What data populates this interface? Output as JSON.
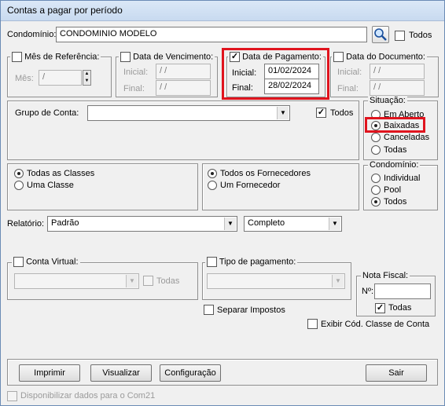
{
  "window": {
    "title": "Contas a pagar por período"
  },
  "condominio": {
    "label": "Condomínio:",
    "value": "CONDOMINIO MODELO",
    "todos_label": "Todos",
    "todos_checked": false
  },
  "mes_referencia": {
    "label": "Mês de Referência:",
    "mes_label": "Mês:",
    "mes_value": "  /"
  },
  "data_vencimento": {
    "label": "Data de Vencimento:",
    "inicial_label": "Inicial:",
    "final_label": "Final:",
    "inicial_value": " /  /",
    "final_value": " /  /"
  },
  "data_pagamento": {
    "label": "Data de Pagamento:",
    "checked": true,
    "inicial_label": "Inicial:",
    "final_label": "Final:",
    "inicial_value": "01/02/2024",
    "final_value": "28/02/2024"
  },
  "data_documento": {
    "label": "Data do Documento:",
    "inicial_label": "Inicial:",
    "final_label": "Final:",
    "inicial_value": " /  /",
    "final_value": " /  /"
  },
  "grupo_conta": {
    "label": "Grupo de Conta:",
    "value": "",
    "todos_label": "Todos",
    "todos_checked": true
  },
  "situacao": {
    "label": "Situação:",
    "options": [
      "Em Aberto",
      "Baixadas",
      "Canceladas",
      "Todas"
    ],
    "selected": "Baixadas"
  },
  "classes": {
    "options": [
      "Todas as Classes",
      "Uma Classe"
    ],
    "selected": "Todas as Classes"
  },
  "fornecedores": {
    "options": [
      "Todos os Fornecedores",
      "Um Fornecedor"
    ],
    "selected": "Todos os Fornecedores"
  },
  "condominio_group": {
    "label": "Condomínio:",
    "options": [
      "Individual",
      "Pool",
      "Todos"
    ],
    "selected": "Todos"
  },
  "relatorio": {
    "label": "Relatório:",
    "value": "Padrão",
    "detail_value": "Completo"
  },
  "conta_virtual": {
    "label": "Conta Virtual:",
    "todas_label": "Todas"
  },
  "tipo_pagamento": {
    "label": "Tipo de pagamento:"
  },
  "nota_fiscal": {
    "label": "Nota Fiscal:",
    "numero_label": "Nº:",
    "todas_label": "Todas",
    "todas_checked": true
  },
  "separar_impostos": {
    "label": "Separar Impostos"
  },
  "exibir_cod_classe": {
    "label": "Exibir Cód. Classe de Conta"
  },
  "buttons": {
    "imprimir": "Imprimir",
    "visualizar": "Visualizar",
    "configuracao": "Configuração",
    "sair": "Sair"
  },
  "disponibilizar": {
    "label": "Disponibilizar dados para o Com21"
  },
  "colors": {
    "highlight": "#e0141e",
    "title_bg": "#c8daf0"
  }
}
